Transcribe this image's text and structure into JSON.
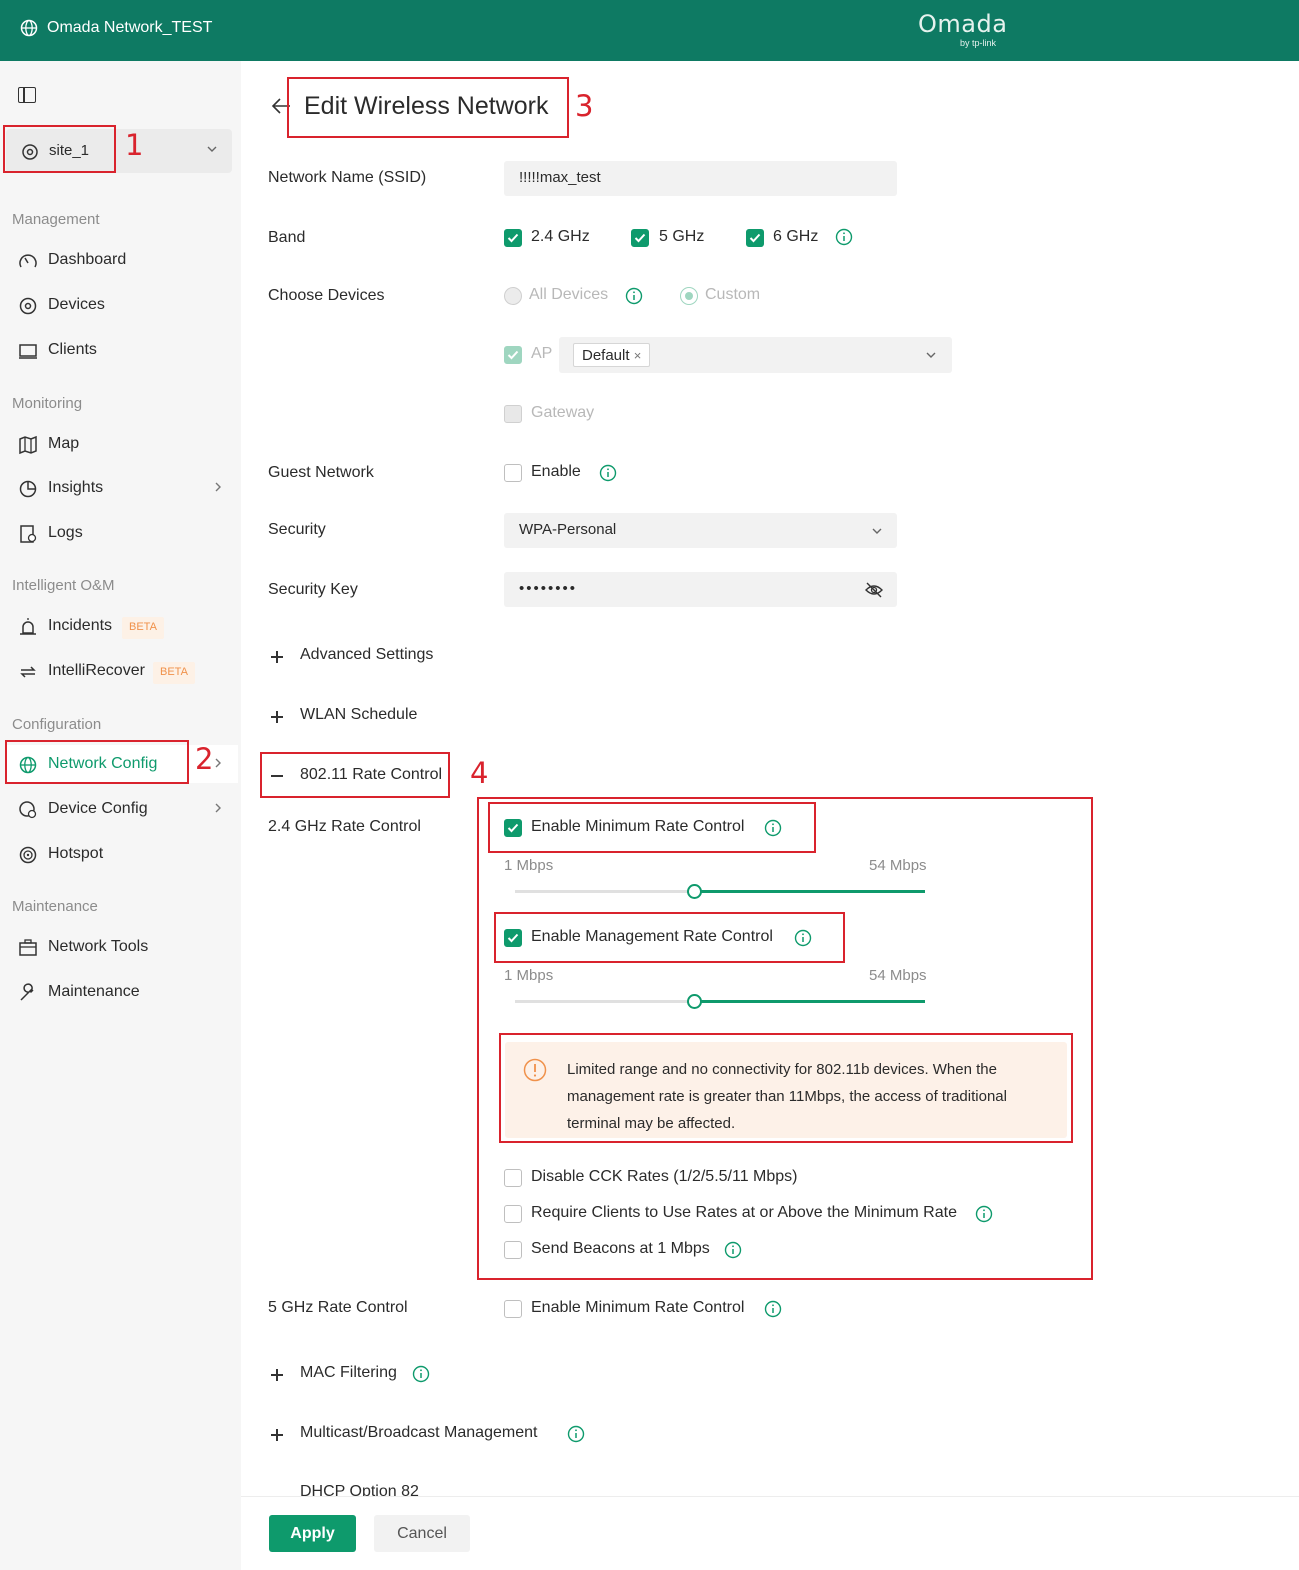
{
  "topbar": {
    "network_name": "Omada Network_TEST",
    "brand": "Omada",
    "brand_sub": "by tp-link"
  },
  "sidebar": {
    "site": "site_1",
    "sections": {
      "management": "Management",
      "monitoring": "Monitoring",
      "intelligent": "Intelligent O&M",
      "configuration": "Configuration",
      "maintenance": "Maintenance"
    },
    "items": {
      "dashboard": "Dashboard",
      "devices": "Devices",
      "clients": "Clients",
      "map": "Map",
      "insights": "Insights",
      "logs": "Logs",
      "incidents": "Incidents",
      "intellirecover": "IntelliRecover",
      "network_config": "Network Config",
      "device_config": "Device Config",
      "hotspot": "Hotspot",
      "network_tools": "Network Tools",
      "maintenance": "Maintenance"
    },
    "beta": "BETA"
  },
  "page": {
    "title": "Edit Wireless Network",
    "ssid_label": "Network Name (SSID)",
    "ssid_value": "!!!!!max_test",
    "band_label": "Band",
    "band_24": "2.4 GHz",
    "band_5": "5 GHz",
    "band_6": "6 GHz",
    "choose_devices_label": "Choose Devices",
    "all_devices": "All Devices",
    "custom": "Custom",
    "ap": "AP",
    "ap_tag": "Default",
    "gateway": "Gateway",
    "guest_label": "Guest Network",
    "guest_enable": "Enable",
    "security_label": "Security",
    "security_value": "WPA-Personal",
    "key_label": "Security Key",
    "key_value": "••••••••",
    "advanced": "Advanced Settings",
    "wlan_schedule": "WLAN Schedule",
    "rate_control": "802.11 Rate Control",
    "rate_24_label": "2.4 GHz Rate Control",
    "enable_min_rate": "Enable Minimum Rate Control",
    "min_label": "1 Mbps",
    "max_label": "54 Mbps",
    "enable_mgmt_rate": "Enable Management Rate Control",
    "warning": "Limited range and no connectivity for 802.11b devices. When the management rate is greater than 11Mbps, the access of traditional terminal may be affected.",
    "disable_cck": "Disable CCK Rates (1/2/5.5/11 Mbps)",
    "require_clients": "Require Clients to Use Rates at or Above the Minimum Rate",
    "send_beacons": "Send Beacons at 1 Mbps",
    "rate_5_label": "5 GHz Rate Control",
    "enable_min_rate_5": "Enable Minimum Rate Control",
    "mac_filtering": "MAC Filtering",
    "multicast": "Multicast/Broadcast Management",
    "dhcp_peek": "DHCP Option 82",
    "sliders": {
      "min_rate_fill": 0.44,
      "mgmt_rate_fill": 0.44
    }
  },
  "footer": {
    "apply": "Apply",
    "cancel": "Cancel"
  },
  "annotations": {
    "n1": "1",
    "n2": "2",
    "n3": "3",
    "n4": "4"
  },
  "colors": {
    "brand": "#0e7a63",
    "accent": "#0e9a6c",
    "annotation": "#d9232d",
    "warning_bg": "#fdf1e8"
  }
}
